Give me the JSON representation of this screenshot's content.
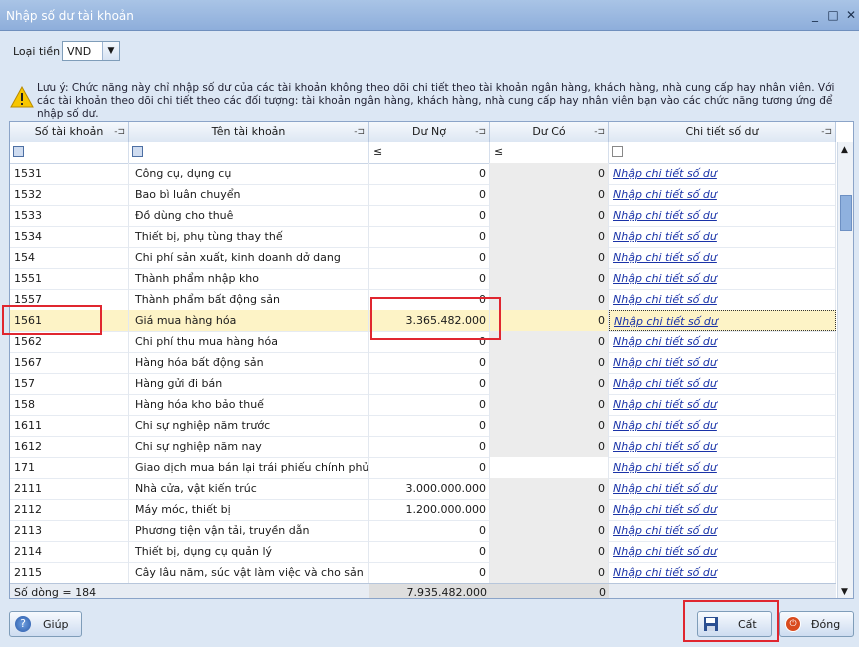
{
  "window": {
    "title": "Nhập số dư tài khoản",
    "minimize_icon": "_",
    "maximize_icon": "□",
    "close_icon": "✕"
  },
  "currency": {
    "label": "Loại tiền",
    "value": "VND"
  },
  "note": "Lưu ý: Chức năng này chỉ nhập số dư của các tài khoản không theo dõi chi tiết theo tài khoản ngân hàng, khách hàng, nhà cung cấp hay nhân viên. Với các tài khoản theo dõi chi tiết theo các đối tượng: tài khoản ngân hàng, khách hàng, nhà cung cấp hay nhân viên bạn vào các chức năng tương ứng để nhập số dư.",
  "grid": {
    "columns": [
      "Số tài khoản",
      "Tên tài khoản",
      "Dư Nợ",
      "Dư Có",
      "Chi tiết số dư"
    ],
    "filter_op": "≤",
    "detail_link": "Nhập chi tiết số dư",
    "rows": [
      {
        "acc": "1531",
        "name": "Công cụ, dụng cụ",
        "debit": "0",
        "credit": "0"
      },
      {
        "acc": "1532",
        "name": "Bao bì luân chuyển",
        "debit": "0",
        "credit": "0"
      },
      {
        "acc": "1533",
        "name": "Đồ dùng cho thuê",
        "debit": "0",
        "credit": "0"
      },
      {
        "acc": "1534",
        "name": "Thiết bị, phụ tùng thay thế",
        "debit": "0",
        "credit": "0"
      },
      {
        "acc": "154",
        "name": "Chi phí sản xuất, kinh doanh dở dang",
        "debit": "0",
        "credit": "0"
      },
      {
        "acc": "1551",
        "name": "Thành phẩm nhập kho",
        "debit": "0",
        "credit": "0"
      },
      {
        "acc": "1557",
        "name": "Thành phẩm bất động sản",
        "debit": "0",
        "credit": "0"
      },
      {
        "acc": "1561",
        "name": "Giá mua hàng hóa",
        "debit": "3.365.482.000",
        "credit": "0"
      },
      {
        "acc": "1562",
        "name": "Chi phí thu mua hàng hóa",
        "debit": "0",
        "credit": "0"
      },
      {
        "acc": "1567",
        "name": "Hàng hóa bất động sản",
        "debit": "0",
        "credit": "0"
      },
      {
        "acc": "157",
        "name": "Hàng gửi đi bán",
        "debit": "0",
        "credit": "0"
      },
      {
        "acc": "158",
        "name": "Hàng hóa kho bảo thuế",
        "debit": "0",
        "credit": "0"
      },
      {
        "acc": "1611",
        "name": "Chi sự nghiệp năm trước",
        "debit": "0",
        "credit": "0"
      },
      {
        "acc": "1612",
        "name": "Chi sự nghiệp năm nay",
        "debit": "0",
        "credit": "0"
      },
      {
        "acc": "171",
        "name": "Giao dịch mua bán lại trái phiếu chính phủ",
        "debit": "0",
        "credit": ""
      },
      {
        "acc": "2111",
        "name": "Nhà cửa, vật kiến trúc",
        "debit": "3.000.000.000",
        "credit": "0"
      },
      {
        "acc": "2112",
        "name": "Máy móc, thiết bị",
        "debit": "1.200.000.000",
        "credit": "0"
      },
      {
        "acc": "2113",
        "name": "Phương tiện vận tải, truyền dẫn",
        "debit": "0",
        "credit": "0"
      },
      {
        "acc": "2114",
        "name": "Thiết bị, dụng cụ quản lý",
        "debit": "0",
        "credit": "0"
      },
      {
        "acc": "2115",
        "name": "Cây lâu năm, súc vật làm việc và cho sản phẩ",
        "debit": "0",
        "credit": "0"
      }
    ],
    "footer": {
      "count": "Số dòng = 184",
      "total_debit": "7.935.482.000",
      "total_credit": "0"
    }
  },
  "buttons": {
    "help": "Giúp",
    "save": "Cất",
    "close": "Đóng"
  },
  "colors": {
    "accent": "#8eaedb",
    "highlight": "#e0262f",
    "link": "#1a33a8"
  }
}
